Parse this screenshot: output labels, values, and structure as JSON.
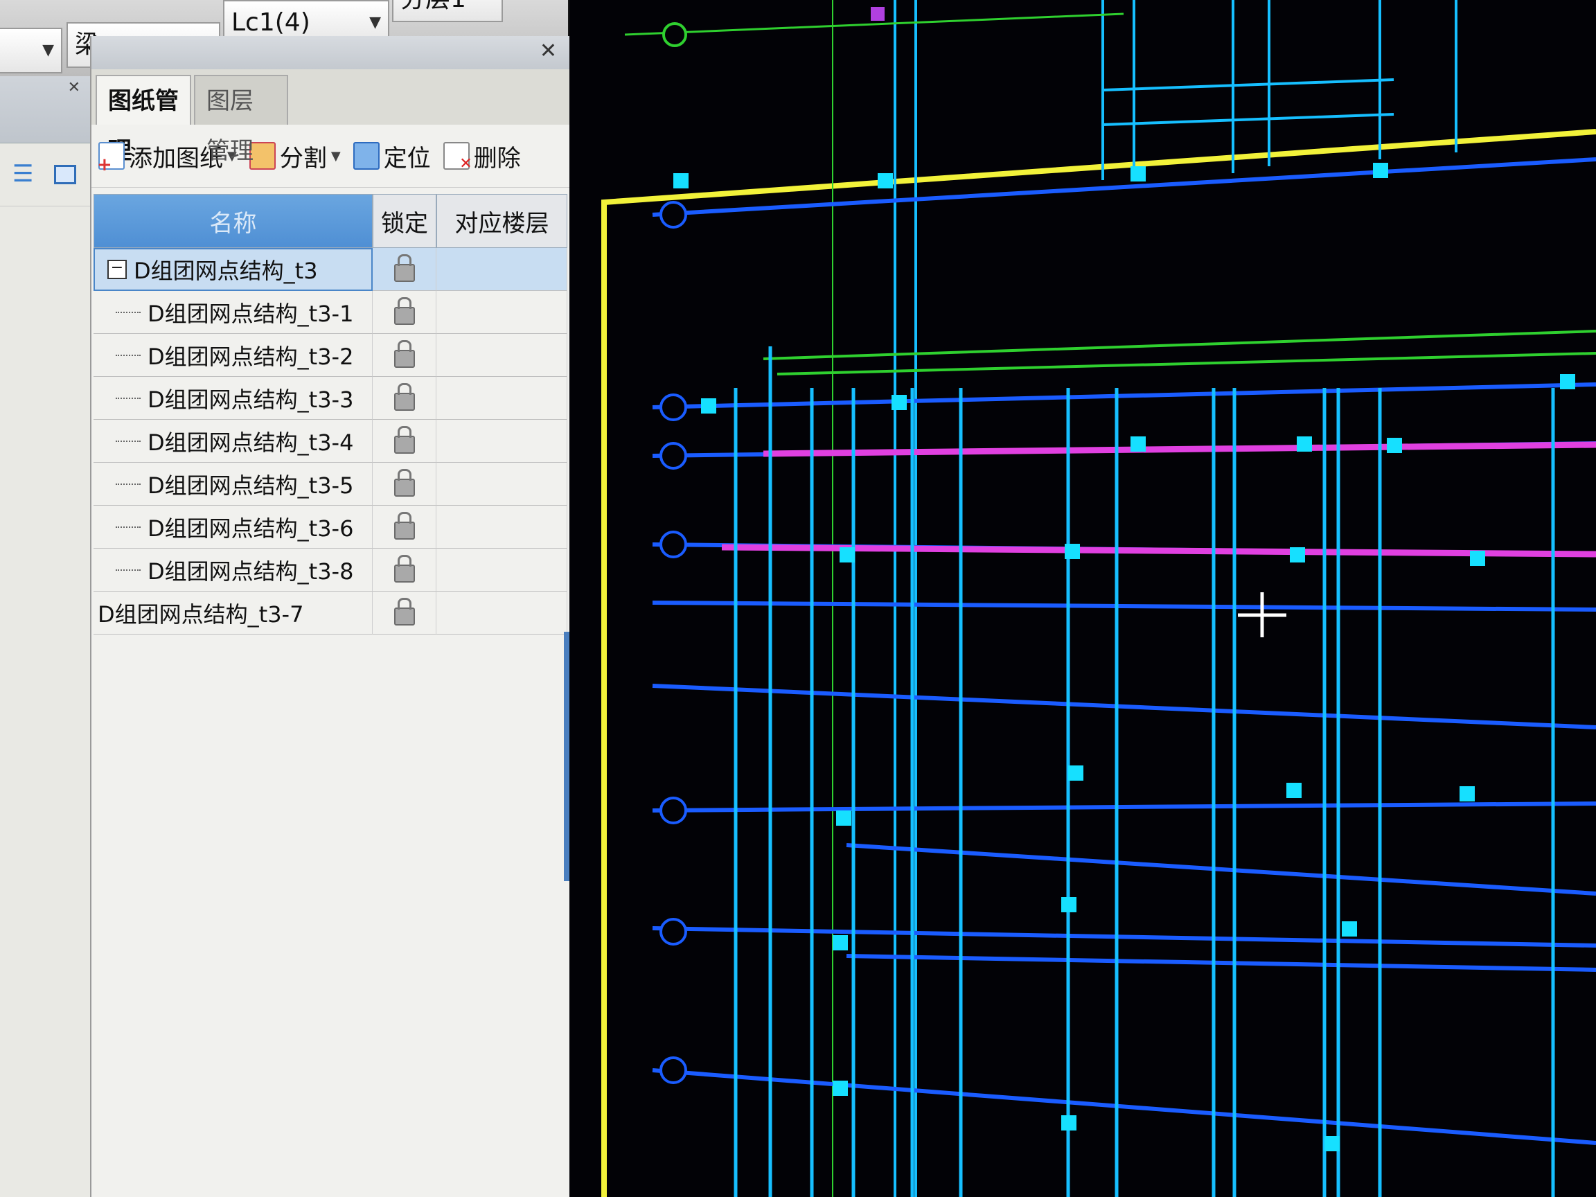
{
  "toolbar_top": {
    "combo_type": "梁",
    "combo_element": "Lc1(4)",
    "combo_layer": "分层1"
  },
  "panel": {
    "tabs": [
      {
        "label": "图纸管理",
        "active": true
      },
      {
        "label": "图层管理",
        "active": false
      }
    ],
    "toolbar": {
      "add_label": "添加图纸",
      "split_label": "分割",
      "locate_label": "定位",
      "delete_label": "删除"
    },
    "table": {
      "headers": {
        "name": "名称",
        "lock": "锁定",
        "floor": "对应楼层"
      },
      "rows": [
        {
          "name": "D组团网点结构_t3",
          "type": "parent",
          "locked": true,
          "floor": ""
        },
        {
          "name": "D组团网点结构_t3-1",
          "type": "child",
          "locked": true,
          "floor": ""
        },
        {
          "name": "D组团网点结构_t3-2",
          "type": "child",
          "locked": true,
          "floor": ""
        },
        {
          "name": "D组团网点结构_t3-3",
          "type": "child",
          "locked": true,
          "floor": ""
        },
        {
          "name": "D组团网点结构_t3-4",
          "type": "child",
          "locked": true,
          "floor": ""
        },
        {
          "name": "D组团网点结构_t3-5",
          "type": "child",
          "locked": true,
          "floor": ""
        },
        {
          "name": "D组团网点结构_t3-6",
          "type": "child",
          "locked": true,
          "floor": ""
        },
        {
          "name": "D组团网点结构_t3-8",
          "type": "child",
          "locked": true,
          "floor": ""
        },
        {
          "name": "D组团网点结构_t3-7",
          "type": "top",
          "locked": true,
          "floor": ""
        }
      ]
    }
  },
  "colors": {
    "canvas_bg": "#020206",
    "beam_blue": "#1a5cff",
    "column_cyan": "#16e0ff",
    "border_yellow": "#f2f23a",
    "axis_green": "#2fd02f",
    "selected_magenta": "#e040e0",
    "panel_header_blue": "#4f8fd4"
  },
  "icons": {
    "close": "close-icon",
    "lock": "lock-icon",
    "crosshair": "crosshair-cursor-icon"
  }
}
